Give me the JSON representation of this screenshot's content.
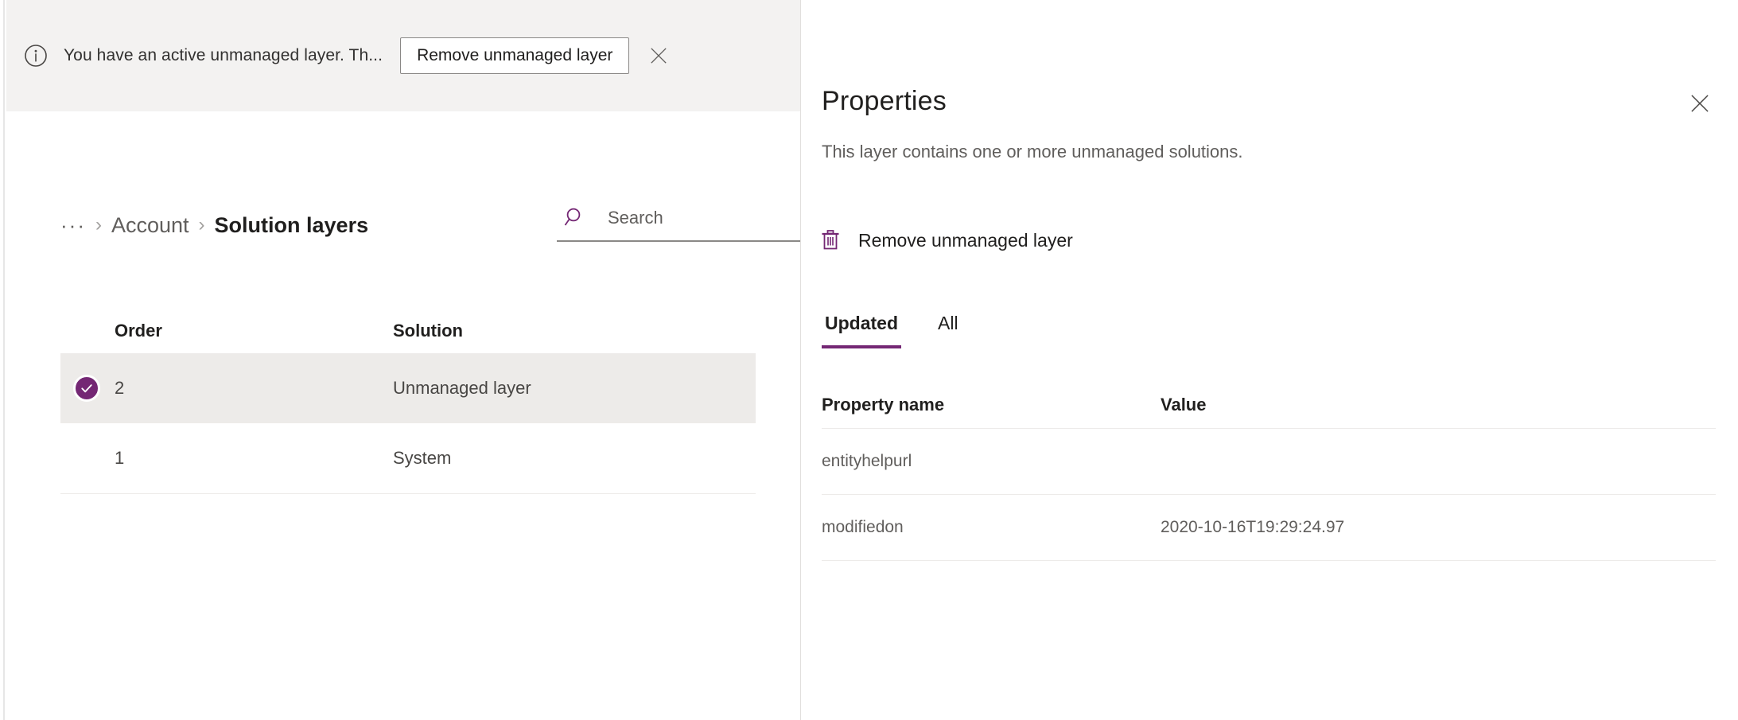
{
  "theme": {
    "accent_purple": "#742774",
    "message_bar_bg": "#f3f2f1",
    "selected_row_bg": "#edebe9",
    "border_gray": "#edebe9"
  },
  "message_bar": {
    "icon": "info-circle-icon",
    "text": "You have an active unmanaged layer. Th...",
    "action_label": "Remove unmanaged layer",
    "close_icon": "close-icon"
  },
  "breadcrumb": {
    "overflow": "···",
    "separator": "›",
    "parent": "Account",
    "current": "Solution layers"
  },
  "search": {
    "icon": "search-icon",
    "placeholder": "Search",
    "value": ""
  },
  "layers_table": {
    "columns": [
      "Order",
      "Solution"
    ],
    "rows": [
      {
        "order": "2",
        "solution": "Unmanaged layer",
        "selected": true
      },
      {
        "order": "1",
        "solution": "System",
        "selected": false
      }
    ]
  },
  "properties_panel": {
    "title": "Properties",
    "subtitle": "This layer contains one or more unmanaged solutions.",
    "close_icon": "close-icon",
    "command": {
      "icon": "trash-icon",
      "label": "Remove unmanaged layer"
    },
    "tabs": [
      {
        "label": "Updated",
        "active": true
      },
      {
        "label": "All",
        "active": false
      }
    ],
    "table": {
      "columns": [
        "Property name",
        "Value"
      ],
      "rows": [
        {
          "name": "entityhelpurl",
          "value": ""
        },
        {
          "name": "modifiedon",
          "value": "2020-10-16T19:29:24.97"
        }
      ]
    }
  }
}
